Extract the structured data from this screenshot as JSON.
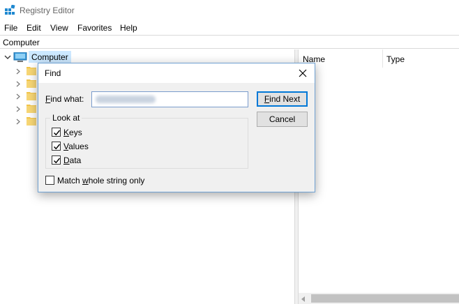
{
  "window": {
    "title": "Registry Editor"
  },
  "menu": {
    "items": [
      "File",
      "Edit",
      "View",
      "Favorites",
      "Help"
    ]
  },
  "address": {
    "path": "Computer"
  },
  "tree": {
    "root_label": "Computer",
    "child_count": 5
  },
  "list": {
    "columns": [
      "Name",
      "Type"
    ]
  },
  "find_dialog": {
    "title": "Find",
    "find_what_label": "Find what:",
    "find_what_value": "",
    "find_next_label": "Find Next",
    "cancel_label": "Cancel",
    "look_at_title": "Look at",
    "options": [
      {
        "label": "Keys",
        "checked": true
      },
      {
        "label": "Values",
        "checked": true
      },
      {
        "label": "Data",
        "checked": true
      }
    ],
    "match_whole_label": "Match whole string only",
    "match_whole_checked": false
  },
  "colors": {
    "accent": "#0078d7",
    "selection": "#cce8ff",
    "dialog_bg": "#f0f0f0"
  },
  "icons": [
    "registry-editor-icon",
    "computer-icon",
    "folder-icon",
    "chevron-right-icon",
    "chevron-down-icon",
    "close-icon",
    "checkmark-icon"
  ]
}
